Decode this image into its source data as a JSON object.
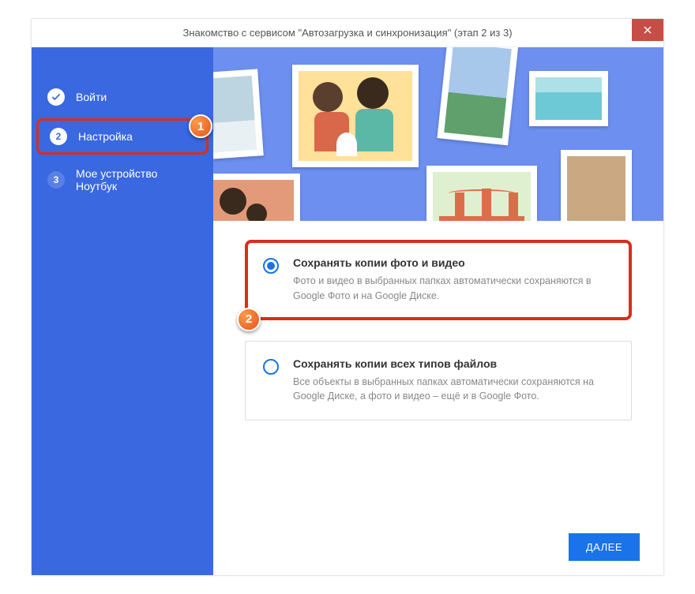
{
  "titlebar": {
    "text": "Знакомство с сервисом \"Автозагрузка и синхронизация\" (этап 2 из 3)"
  },
  "sidebar": {
    "steps": [
      {
        "label": "Войти"
      },
      {
        "label": "Настройка"
      },
      {
        "label": "Мое устройство Ноутбук"
      }
    ]
  },
  "options": [
    {
      "title": "Сохранять копии фото и видео",
      "desc": "Фото и видео в выбранных папках автоматически сохраняются в Google Фото и на Google Диске."
    },
    {
      "title": "Сохранять копии всех типов файлов",
      "desc": "Все объекты в выбранных папках автоматически сохраняются на Google Диске, а фото и видео – ещё и в Google Фото."
    }
  ],
  "footer": {
    "next": "ДАЛЕЕ"
  },
  "badges": {
    "one": "1",
    "two": "2"
  },
  "step_numbers": {
    "two": "2",
    "three": "3"
  }
}
